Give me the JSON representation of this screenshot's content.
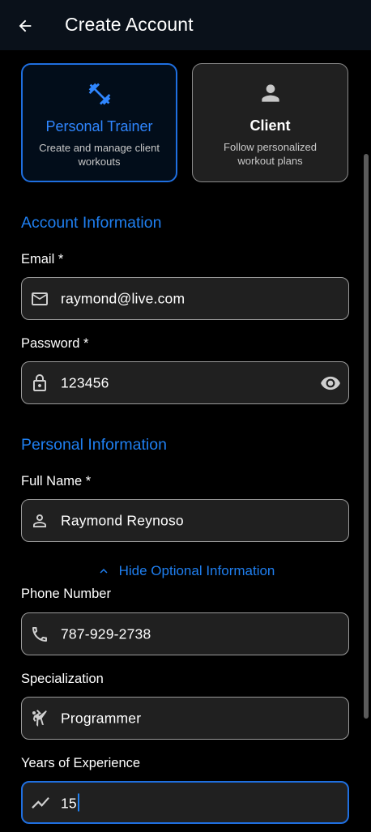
{
  "header": {
    "title": "Create Account"
  },
  "roles": [
    {
      "title": "Personal Trainer",
      "description": "Create and manage client workouts",
      "selected": true
    },
    {
      "title": "Client",
      "description": "Follow personalized workout plans",
      "selected": false
    }
  ],
  "sections": {
    "account": "Account Information",
    "personal": "Personal Information"
  },
  "fields": {
    "email": {
      "label": "Email *",
      "value": "raymond@live.com"
    },
    "password": {
      "label": "Password *",
      "value": "123456"
    },
    "full_name": {
      "label": "Full Name *",
      "value": "Raymond Reynoso"
    },
    "phone": {
      "label": "Phone Number",
      "value": "787-929-2738"
    },
    "specialization": {
      "label": "Specialization",
      "value": "Programmer"
    },
    "experience": {
      "label": "Years of Experience",
      "value": "15"
    }
  },
  "toggle_optional": {
    "label": "Hide Optional Information"
  },
  "colors": {
    "accent": "#1f7ff0",
    "background": "#000000",
    "surface": "#202020",
    "header": "#0a111a"
  },
  "icons": {
    "back": "arrow-left-icon",
    "trainer": "dumbbell-icon",
    "client": "person-icon",
    "email": "mail-icon",
    "password": "lock-icon",
    "visibility": "eye-icon",
    "name": "person-outline-icon",
    "chevron": "chevron-up-icon",
    "phone": "phone-icon",
    "specialization": "sports-martial-arts-icon",
    "experience": "trending-line-icon"
  }
}
